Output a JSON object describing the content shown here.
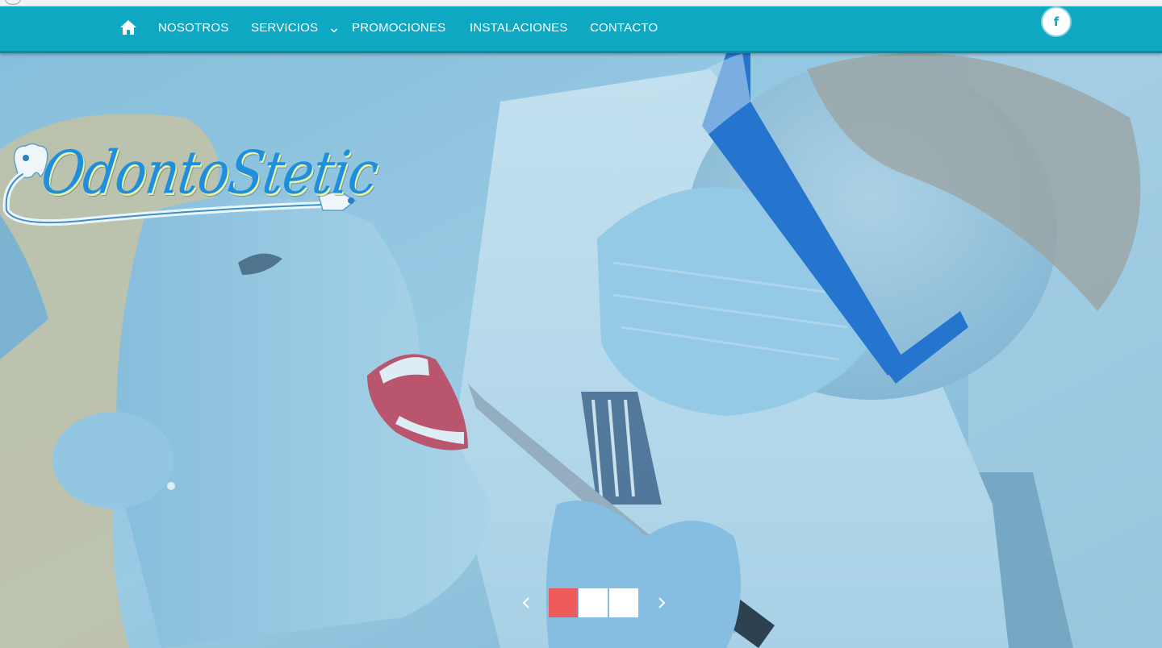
{
  "nav": {
    "home_icon": "home-icon",
    "items": [
      {
        "label": "NOSOTROS"
      },
      {
        "label": "SERVICIOS",
        "has_dropdown": true
      },
      {
        "label": "PROMOCIONES"
      },
      {
        "label": "INSTALACIONES"
      },
      {
        "label": "CONTACTO"
      }
    ],
    "social": {
      "facebook_glyph": "f",
      "icon": "facebook-icon"
    }
  },
  "hero": {
    "logo_text": "OdontoStetic",
    "slider": {
      "slide_count": 3,
      "active_index": 0,
      "prev_icon": "chevron-left-icon",
      "next_icon": "chevron-right-icon"
    }
  },
  "colors": {
    "nav_bg": "#0fa8c2",
    "active_dot": "#ef5a5a",
    "logo_blue": "#1e8fdc",
    "hero_tint": "#6fb3d3"
  }
}
